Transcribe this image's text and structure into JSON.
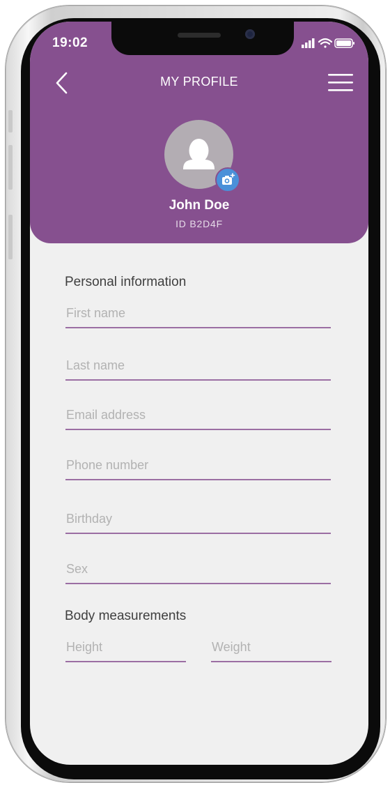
{
  "status_bar": {
    "time": "19:02"
  },
  "header": {
    "title": "MY PROFILE",
    "user_name": "John Doe",
    "user_id": "ID  B2D4F"
  },
  "personal_info": {
    "title": "Personal information",
    "fields": [
      {
        "placeholder": "First name",
        "value": ""
      },
      {
        "placeholder": "Last name",
        "value": ""
      },
      {
        "placeholder": "Email address",
        "value": ""
      },
      {
        "placeholder": "Phone number",
        "value": ""
      },
      {
        "placeholder": "Birthday",
        "value": ""
      },
      {
        "placeholder": "Sex",
        "value": ""
      }
    ]
  },
  "body_measurements": {
    "title": "Body measurements",
    "fields": [
      {
        "placeholder": "Height",
        "value": ""
      },
      {
        "placeholder": "Weight",
        "value": ""
      }
    ]
  },
  "colors": {
    "header": "#86508f",
    "accent": "#9b6ea3",
    "camera_badge": "#4a90d9",
    "background": "#f0f0f0"
  },
  "icons": [
    "back-chevron-icon",
    "hamburger-menu-icon",
    "user-avatar-icon",
    "camera-add-icon",
    "signal-icon",
    "wifi-icon",
    "battery-icon"
  ]
}
